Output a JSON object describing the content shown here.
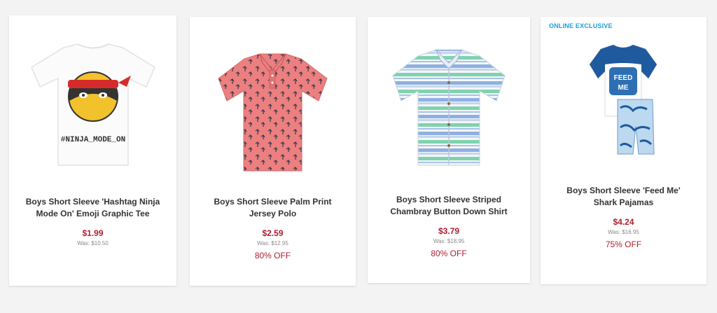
{
  "products": [
    {
      "title": "Boys Short Sleeve 'Hashtag Ninja Mode On' Emoji Graphic Tee",
      "price": "$1.99",
      "was": "Was: $10.50",
      "image_text": "#NINJA_MODE_ON"
    },
    {
      "title": "Boys Short Sleeve Palm Print Jersey Polo",
      "price": "$2.59",
      "was": "Was: $12.95",
      "discount": "80% OFF"
    },
    {
      "title": "Boys Short Sleeve Striped Chambray Button Down Shirt",
      "price": "$3.79",
      "was": "Was: $18.95",
      "discount": "80% OFF"
    },
    {
      "badge": "ONLINE EXCLUSIVE",
      "title": "Boys Short Sleeve 'Feed Me' Shark Pajamas",
      "price": "$4.24",
      "was": "Was: $16.95",
      "discount": "75% OFF"
    }
  ],
  "colors": {
    "price": "#b01c2e",
    "badge": "#1a9fd9"
  }
}
